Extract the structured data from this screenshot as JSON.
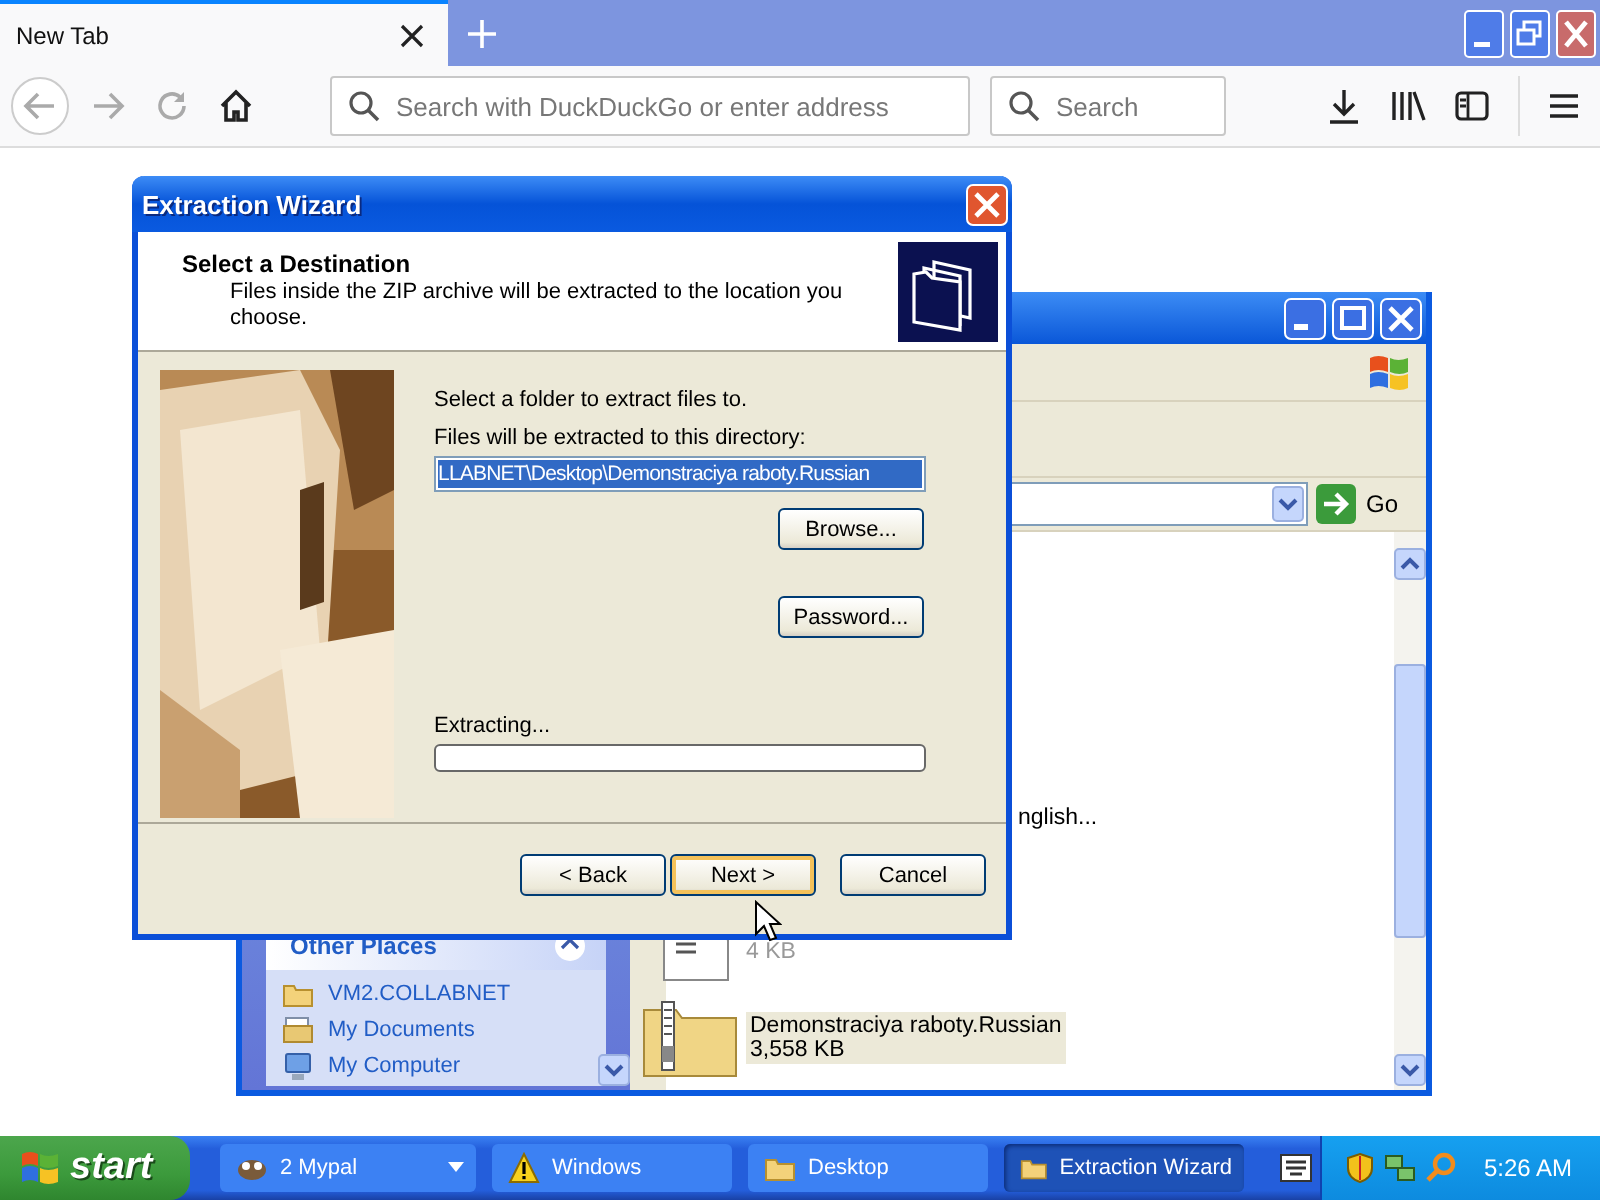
{
  "browser": {
    "tabs": [
      {
        "label": "New Tab",
        "selected": true
      }
    ],
    "address_placeholder": "Search with DuckDuckGo or enter address",
    "search_placeholder": "Search"
  },
  "explorer": {
    "go_label": "Go",
    "files": [
      {
        "kind": "partial",
        "name": "nglish..."
      },
      {
        "kind": "document",
        "size": "4 KB"
      },
      {
        "kind": "zip",
        "name": "Demonstraciya raboty.Russian",
        "size": "3,558 KB"
      }
    ],
    "other_places": {
      "title": "Other Places",
      "items": [
        {
          "kind": "folder",
          "label": "VM2.COLLABNET"
        },
        {
          "kind": "documents",
          "label": "My Documents"
        },
        {
          "kind": "computer",
          "label": "My Computer"
        }
      ]
    }
  },
  "wizard": {
    "title": "Extraction Wizard",
    "heading": "Select a Destination",
    "subtitle": "Files inside the ZIP archive will be extracted to the location you choose.",
    "prompt": "Select a folder to extract files to.",
    "directory_label": "Files will be extracted to this directory:",
    "directory": "LLABNET\\Desktop\\Demonstraciya raboty.Russian",
    "side_buttons": [
      "Browse...",
      "Password..."
    ],
    "progress": {
      "label": "Extracting...",
      "level": 0
    },
    "nav_buttons": [
      {
        "label": "< Back",
        "default": false
      },
      {
        "label": "Next >",
        "default": true
      },
      {
        "label": "Cancel",
        "default": false
      }
    ]
  },
  "taskbar": {
    "start": "start",
    "items": [
      {
        "kind": "group",
        "label": "2 Mypal",
        "selected": false
      },
      {
        "kind": "warning",
        "label": "Windows",
        "selected": false
      },
      {
        "kind": "folder",
        "label": "Desktop",
        "selected": false
      },
      {
        "kind": "folder",
        "label": "Extraction Wizard",
        "selected": true
      }
    ],
    "clock": "5:26 AM"
  }
}
